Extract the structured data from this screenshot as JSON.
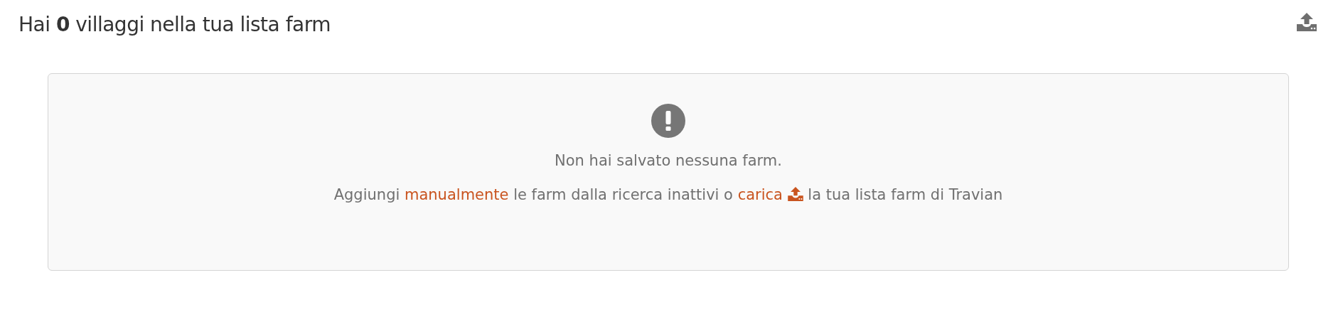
{
  "header": {
    "title": "Hai **0** villaggi nella tua lista farm"
  },
  "empty_state": {
    "message": "Non hai salvato nessuna farm.",
    "instruction": [
      {
        "kind": "text",
        "text": "Aggiungi "
      },
      {
        "kind": "link",
        "text": "manualmente"
      },
      {
        "kind": "text",
        "text": " le farm dalla ricerca inattivi o "
      },
      {
        "kind": "link_upload",
        "text": "carica"
      },
      {
        "kind": "text",
        "text": " la tua lista farm di Travian"
      }
    ]
  }
}
